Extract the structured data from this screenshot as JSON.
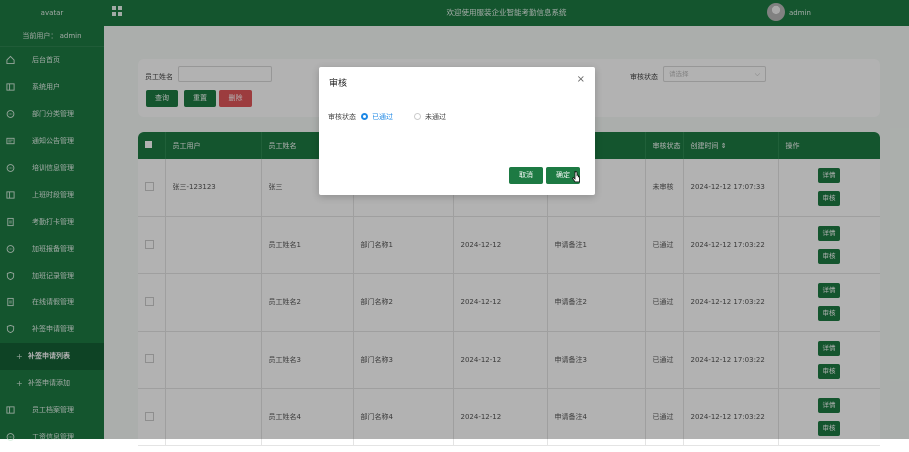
{
  "sidebar": {
    "logo": "avatar",
    "current_user": "当前用户：  admin",
    "items": [
      {
        "label": "后台首页",
        "icon": "home-icon"
      },
      {
        "label": "系统用户",
        "icon": "columns-icon"
      },
      {
        "label": "部门分类管理",
        "icon": "chat-icon"
      },
      {
        "label": "通知公告管理",
        "icon": "card-icon"
      },
      {
        "label": "培训信息管理",
        "icon": "chat-icon"
      },
      {
        "label": "上班时段管理",
        "icon": "columns-icon"
      },
      {
        "label": "考勤打卡管理",
        "icon": "document-icon"
      },
      {
        "label": "加班报备管理",
        "icon": "chat-icon"
      },
      {
        "label": "加班记录管理",
        "icon": "shield-icon"
      },
      {
        "label": "在线请假管理",
        "icon": "document-icon"
      },
      {
        "label": "补签申请管理",
        "icon": "shield-icon"
      }
    ],
    "sub_items": [
      "补签申请列表",
      "补签申请添加"
    ],
    "bottom_items": [
      {
        "label": "员工档案管理",
        "icon": "columns-icon"
      },
      {
        "label": "工资信息管理",
        "icon": "chat-icon"
      }
    ]
  },
  "header": {
    "title": "欢迎使用服装企业智能考勤信息系统",
    "username": "admin"
  },
  "search": {
    "name_label": "员工姓名",
    "status_label": "审核状态",
    "status_placeholder": "请选择",
    "query_button": "查询",
    "reset_button": "重置",
    "delete_button": "删除"
  },
  "table": {
    "columns": [
      "",
      "员工用户",
      "员工姓名",
      "部门名称",
      "补签日期",
      "申请备注",
      "审核状态",
      "创建时间 ⇕",
      "操作"
    ],
    "rows": [
      [
        "张三-123123",
        "张三",
        "",
        "",
        "",
        "未审核",
        "2024-12-12 17:07:33"
      ],
      [
        "",
        "员工姓名1",
        "部门名称1",
        "2024-12-12",
        "申请备注1",
        "已通过",
        "2024-12-12 17:03:22"
      ],
      [
        "",
        "员工姓名2",
        "部门名称2",
        "2024-12-12",
        "申请备注2",
        "已通过",
        "2024-12-12 17:03:22"
      ],
      [
        "",
        "员工姓名3",
        "部门名称3",
        "2024-12-12",
        "申请备注3",
        "已通过",
        "2024-12-12 17:03:22"
      ],
      [
        "",
        "员工姓名4",
        "部门名称4",
        "2024-12-12",
        "申请备注4",
        "已通过",
        "2024-12-12 17:03:22"
      ]
    ],
    "detail_button": "详情",
    "review_button": "审核"
  },
  "modal": {
    "title": "审核",
    "close_icon": "×",
    "label": "审核状态",
    "options": [
      "已通过",
      "未通过"
    ],
    "selected": "已通过",
    "cancel_button": "取消",
    "confirm_button": "确定"
  },
  "colors": {
    "primary": "#1d7a43",
    "danger": "#e0565a",
    "radio_selected": "#1e88e5"
  }
}
